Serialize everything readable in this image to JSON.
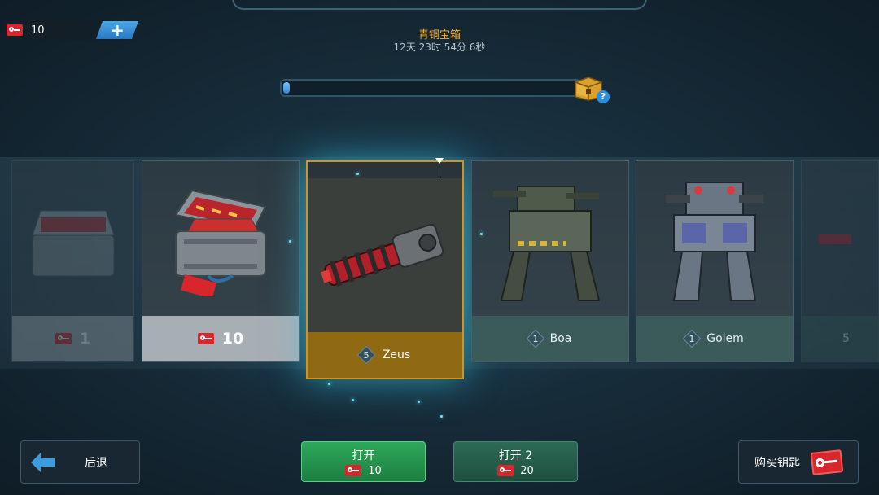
{
  "header": {
    "key_count": "10",
    "add_keys_symbol": "+",
    "chest_title": "青铜宝箱",
    "chest_timer": "12天 23时 54分 6秒",
    "progress": 0.02,
    "help_symbol": "?"
  },
  "carousel": {
    "cards": [
      {
        "type": "keys",
        "count": "1",
        "faded": true
      },
      {
        "type": "keys",
        "count": "10"
      },
      {
        "type": "weapon",
        "level": "5",
        "name": "Zeus",
        "selected": true
      },
      {
        "type": "robot",
        "level": "1",
        "name": "Boa"
      },
      {
        "type": "robot",
        "level": "1",
        "name": "Golem"
      },
      {
        "type": "partial",
        "level": "5",
        "faded": true
      }
    ]
  },
  "buttons": {
    "back_label": "后退",
    "open_label": "打开",
    "open_cost": "10",
    "open2_label": "打开 2",
    "open2_cost": "20",
    "buy_keys_label": "购买钥匙"
  },
  "colors": {
    "accent_gold": "#f2b134",
    "selected_footer": "#8f6a12",
    "key_red": "#d9262c",
    "open_green": "#2fa85a"
  },
  "icons": {
    "key": "key-icon",
    "add": "plus-icon",
    "chest": "gold-chest-icon",
    "back": "arrow-left-icon"
  }
}
